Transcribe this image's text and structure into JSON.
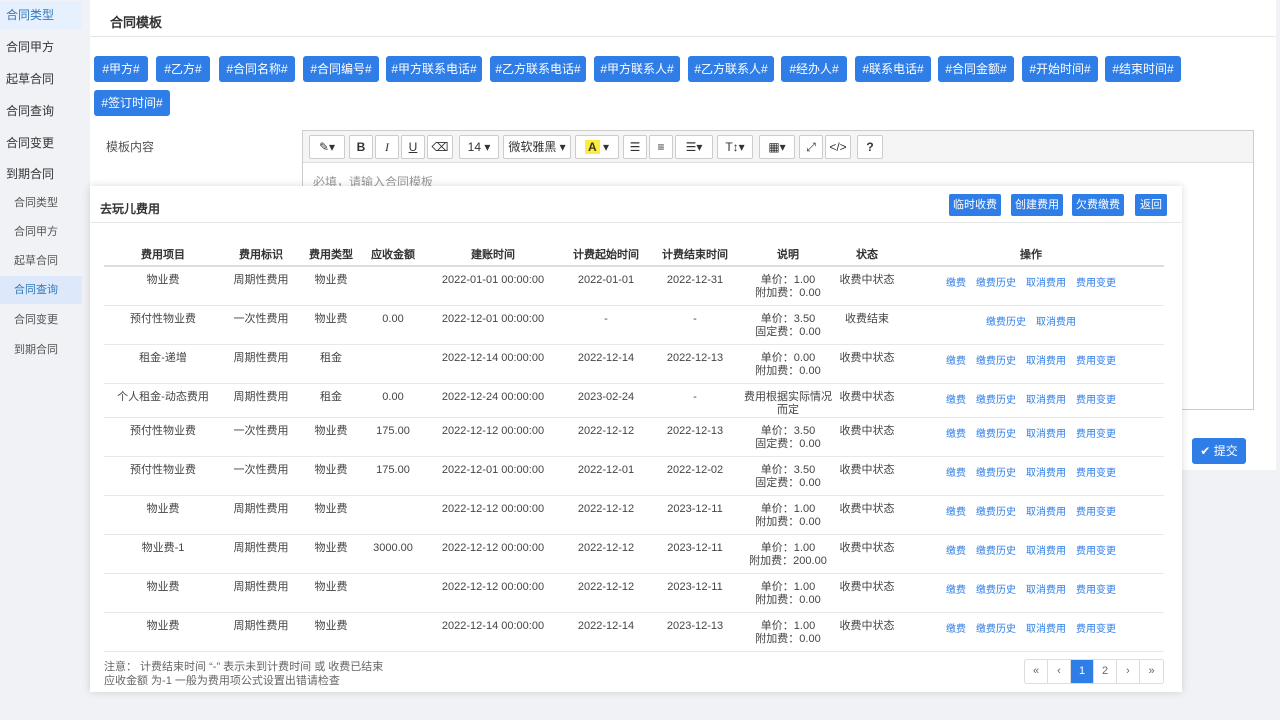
{
  "sidebar": {
    "items": [
      {
        "label": "合同类型"
      },
      {
        "label": "合同甲方"
      },
      {
        "label": "起草合同"
      },
      {
        "label": "合同查询"
      },
      {
        "label": "合同变更"
      },
      {
        "label": "到期合同"
      }
    ],
    "subitems": [
      {
        "label": "合同类型"
      },
      {
        "label": "合同甲方"
      },
      {
        "label": "起草合同"
      },
      {
        "label": "合同查询"
      },
      {
        "label": "合同变更"
      },
      {
        "label": "到期合同"
      }
    ]
  },
  "template": {
    "title": "合同模板",
    "tags": [
      "#甲方#",
      "#乙方#",
      "#合同名称#",
      "#合同编号#",
      "#甲方联系电话#",
      "#乙方联系电话#",
      "#甲方联系人#",
      "#乙方联系人#",
      "#经办人#",
      "#联系电话#",
      "#合同金额#",
      "#开始时间#",
      "#结束时间#",
      "#签订时间#"
    ],
    "content_label": "模板内容",
    "editor": {
      "font_size": "14",
      "font_family": "微软雅黑",
      "color_button": "A",
      "help": "?",
      "placeholder": "必填，请输入合同模板"
    },
    "submit": "提交"
  },
  "modal": {
    "title": "去玩儿费用",
    "buttons": [
      "临时收费",
      "创建费用",
      "欠费缴费",
      "返回"
    ],
    "columns": [
      "费用项目",
      "费用标识",
      "费用类型",
      "应收金额",
      "建账时间",
      "计费起始时间",
      "计费结束时间",
      "说明",
      "状态",
      "操作"
    ],
    "rows": [
      {
        "item": "物业费",
        "flag": "周期性费用",
        "type": "物业费",
        "amount": "",
        "created": "2022-01-01 00:00:00",
        "start": "2022-01-01",
        "end": "2022-12-31",
        "desc1": "单价：1.00",
        "desc2": "附加费：0.00",
        "status": "收费中状态",
        "ops": [
          "缴费",
          "缴费历史",
          "取消费用",
          "费用变更"
        ]
      },
      {
        "item": "预付性物业费",
        "flag": "一次性费用",
        "type": "物业费",
        "amount": "0.00",
        "created": "2022-12-01 00:00:00",
        "start": "-",
        "end": "-",
        "desc1": "单价：3.50",
        "desc2": "固定费：0.00",
        "status": "收费结束",
        "ops": [
          "缴费历史",
          "取消费用"
        ]
      },
      {
        "item": "租金-递增",
        "flag": "周期性费用",
        "type": "租金",
        "amount": "",
        "created": "2022-12-14 00:00:00",
        "start": "2022-12-14",
        "end": "2022-12-13",
        "desc1": "单价：0.00",
        "desc2": "附加费：0.00",
        "status": "收费中状态",
        "ops": [
          "缴费",
          "缴费历史",
          "取消费用",
          "费用变更"
        ]
      },
      {
        "item": "个人租金-动态费用",
        "flag": "周期性费用",
        "type": "租金",
        "amount": "0.00",
        "created": "2022-12-24 00:00:00",
        "start": "2023-02-24",
        "end": "-",
        "desc1": "费用根据实际情况而定",
        "desc2": "",
        "status": "收费中状态",
        "ops": [
          "缴费",
          "缴费历史",
          "取消费用",
          "费用变更"
        ]
      },
      {
        "item": "预付性物业费",
        "flag": "一次性费用",
        "type": "物业费",
        "amount": "175.00",
        "created": "2022-12-12 00:00:00",
        "start": "2022-12-12",
        "end": "2022-12-13",
        "desc1": "单价：3.50",
        "desc2": "固定费：0.00",
        "status": "收费中状态",
        "ops": [
          "缴费",
          "缴费历史",
          "取消费用",
          "费用变更"
        ]
      },
      {
        "item": "预付性物业费",
        "flag": "一次性费用",
        "type": "物业费",
        "amount": "175.00",
        "created": "2022-12-01 00:00:00",
        "start": "2022-12-01",
        "end": "2022-12-02",
        "desc1": "单价：3.50",
        "desc2": "固定费：0.00",
        "status": "收费中状态",
        "ops": [
          "缴费",
          "缴费历史",
          "取消费用",
          "费用变更"
        ]
      },
      {
        "item": "物业费",
        "flag": "周期性费用",
        "type": "物业费",
        "amount": "",
        "created": "2022-12-12 00:00:00",
        "start": "2022-12-12",
        "end": "2023-12-11",
        "desc1": "单价：1.00",
        "desc2": "附加费：0.00",
        "status": "收费中状态",
        "ops": [
          "缴费",
          "缴费历史",
          "取消费用",
          "费用变更"
        ]
      },
      {
        "item": "物业费-1",
        "flag": "周期性费用",
        "type": "物业费",
        "amount": "3000.00",
        "created": "2022-12-12 00:00:00",
        "start": "2022-12-12",
        "end": "2023-12-11",
        "desc1": "单价：1.00",
        "desc2": "附加费：200.00",
        "status": "收费中状态",
        "ops": [
          "缴费",
          "缴费历史",
          "取消费用",
          "费用变更"
        ]
      },
      {
        "item": "物业费",
        "flag": "周期性费用",
        "type": "物业费",
        "amount": "",
        "created": "2022-12-12 00:00:00",
        "start": "2022-12-12",
        "end": "2023-12-11",
        "desc1": "单价：1.00",
        "desc2": "附加费：0.00",
        "status": "收费中状态",
        "ops": [
          "缴费",
          "缴费历史",
          "取消费用",
          "费用变更"
        ]
      },
      {
        "item": "物业费",
        "flag": "周期性费用",
        "type": "物业费",
        "amount": "",
        "created": "2022-12-14 00:00:00",
        "start": "2022-12-14",
        "end": "2023-12-13",
        "desc1": "单价：1.00",
        "desc2": "附加费：0.00",
        "status": "收费中状态",
        "ops": [
          "缴费",
          "缴费历史",
          "取消费用",
          "费用变更"
        ]
      }
    ],
    "note_line1": "注意：  计费结束时间  “-”  表示未到计费时间 或 收费已结束",
    "note_line2": "应收金额 为-1 一般为费用项公式设置出错请检查",
    "pager": [
      "«",
      "‹",
      "1",
      "2",
      "›",
      "»"
    ],
    "pager_active": "1"
  }
}
